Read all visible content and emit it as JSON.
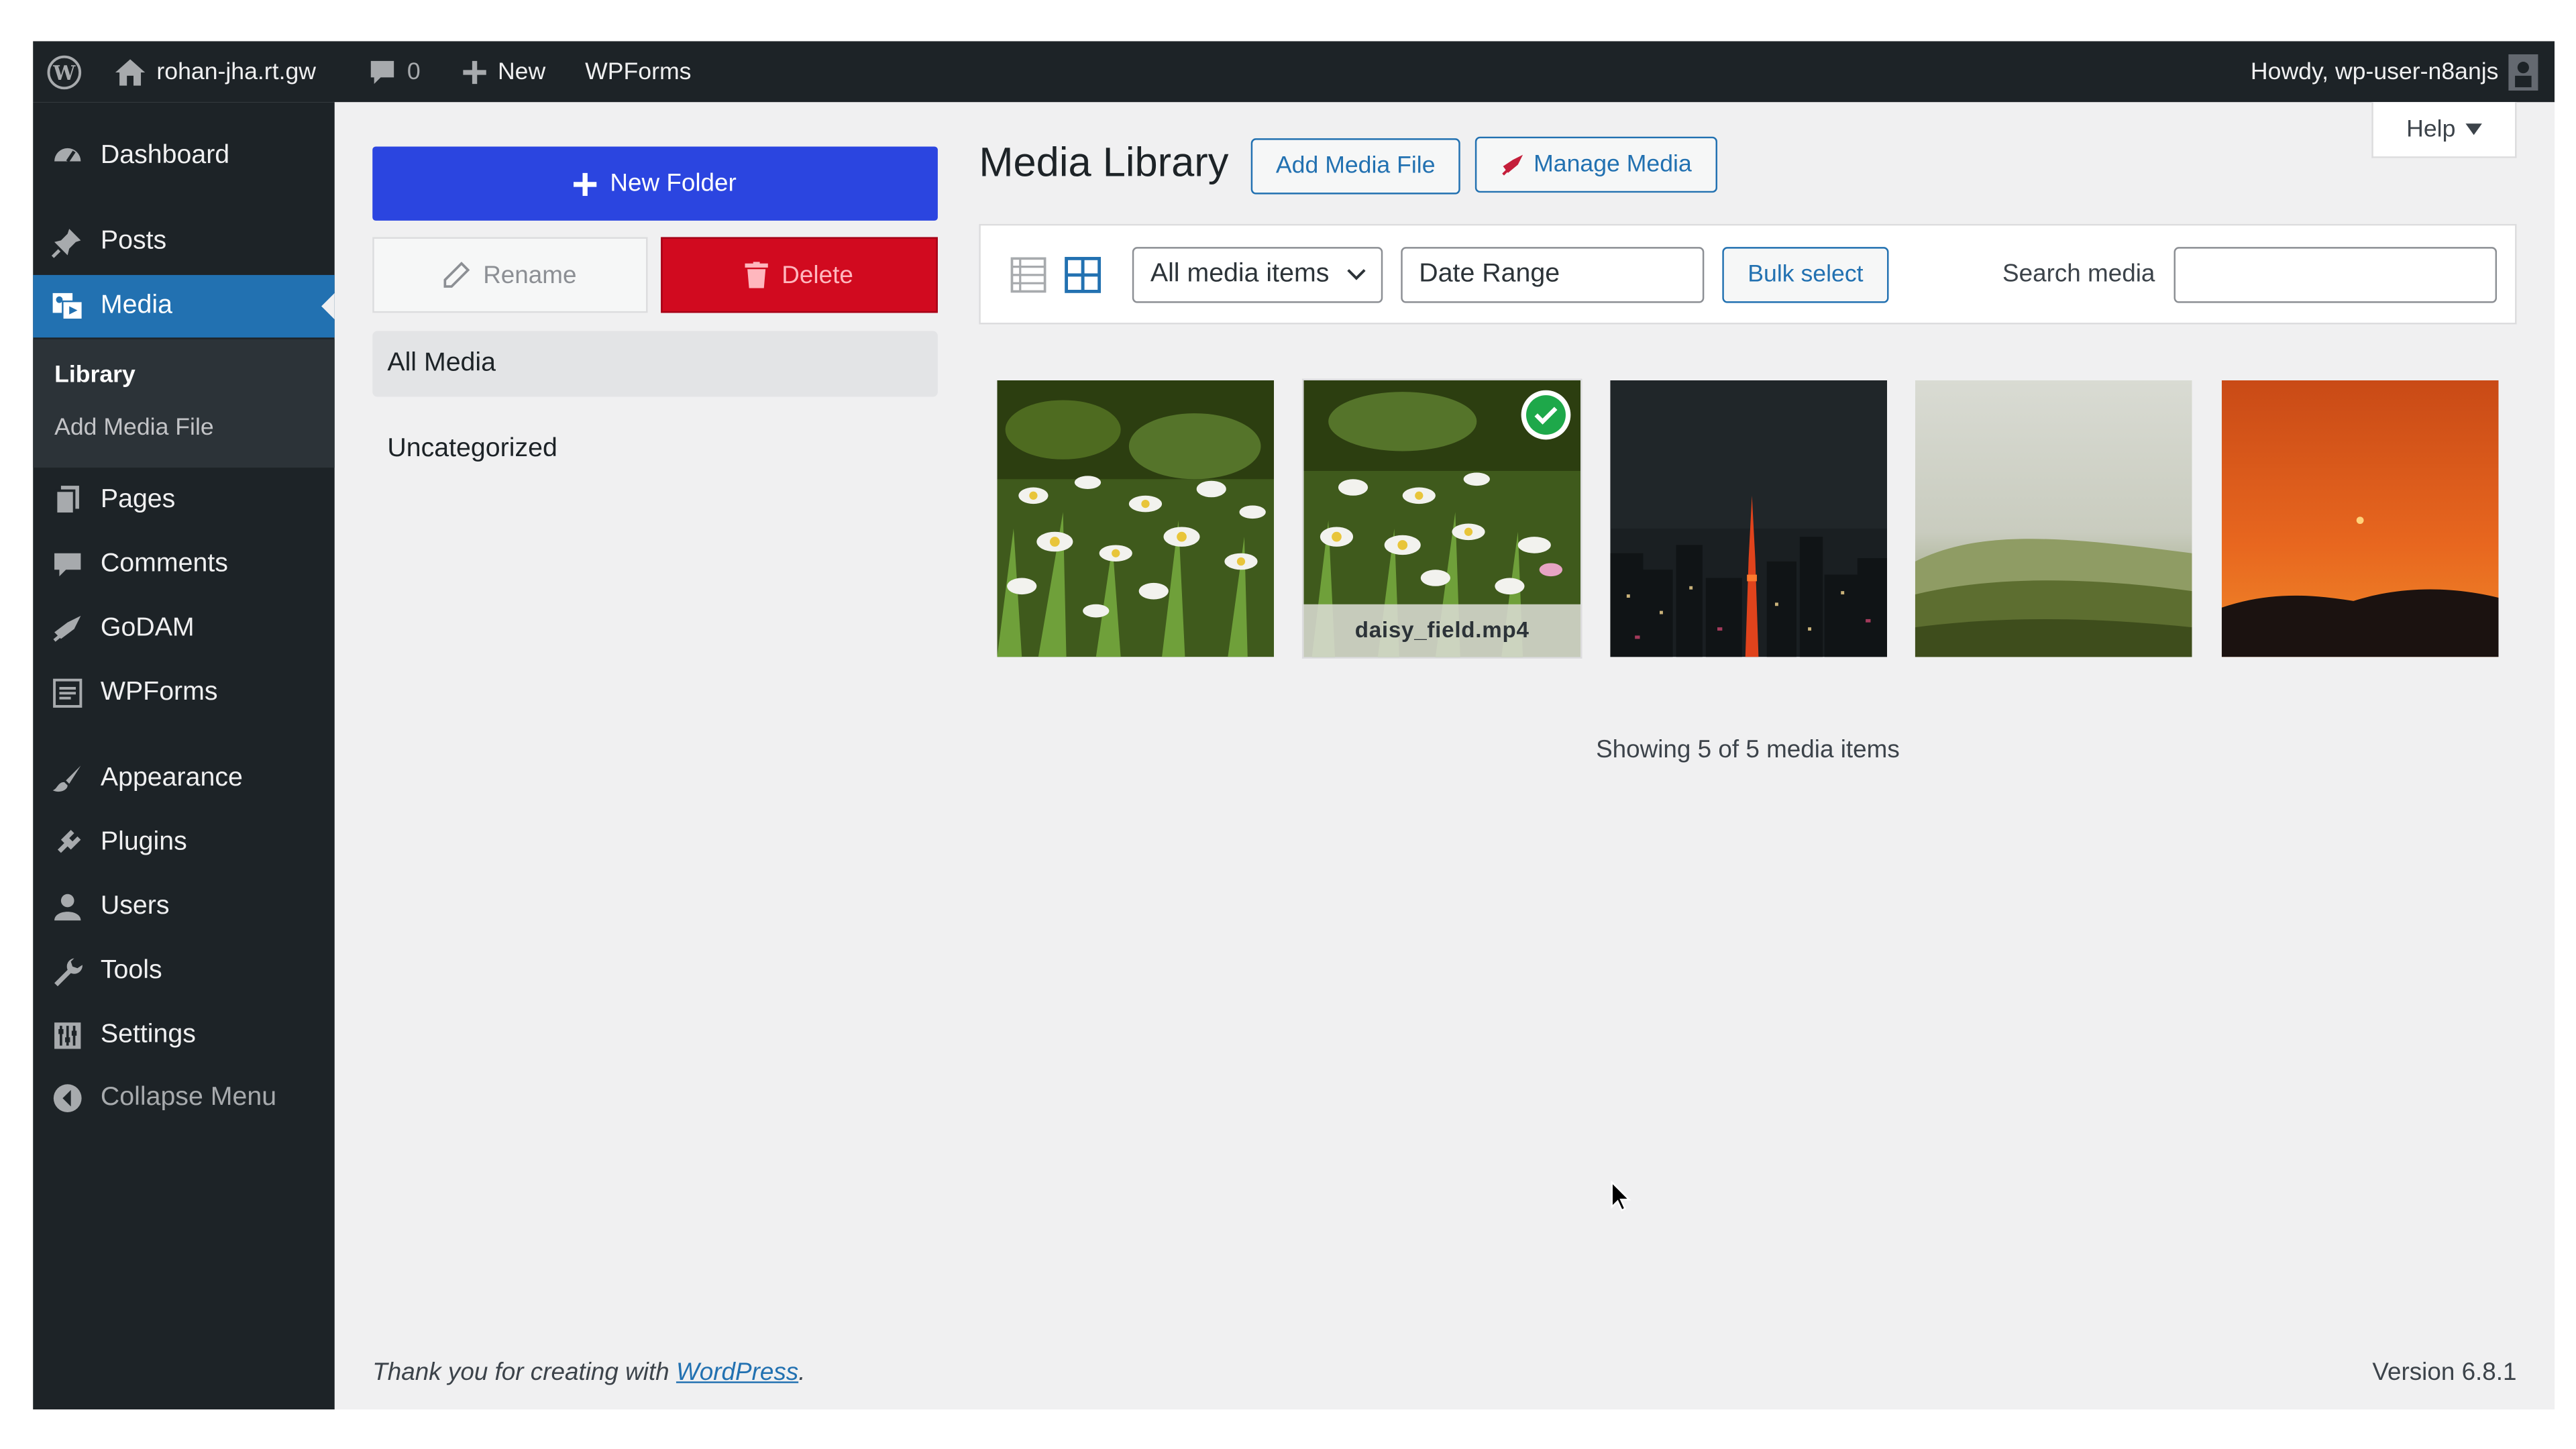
{
  "admin_bar": {
    "site_name": "rohan-jha.rt.gw",
    "comments_count": "0",
    "new_label": "New",
    "wpforms_label": "WPForms",
    "howdy": "Howdy, wp-user-n8anjs"
  },
  "sidebar": {
    "items": [
      {
        "label": "Dashboard",
        "icon": "dashboard-icon"
      },
      {
        "label": "Posts",
        "icon": "pin-icon"
      },
      {
        "label": "Media",
        "icon": "media-icon"
      },
      {
        "label": "Pages",
        "icon": "pages-icon"
      },
      {
        "label": "Comments",
        "icon": "comment-icon"
      },
      {
        "label": "GoDAM",
        "icon": "godam-icon"
      },
      {
        "label": "WPForms",
        "icon": "form-icon"
      },
      {
        "label": "Appearance",
        "icon": "brush-icon"
      },
      {
        "label": "Plugins",
        "icon": "plug-icon"
      },
      {
        "label": "Users",
        "icon": "user-icon"
      },
      {
        "label": "Tools",
        "icon": "wrench-icon"
      },
      {
        "label": "Settings",
        "icon": "sliders-icon"
      },
      {
        "label": "Collapse Menu",
        "icon": "collapse-icon"
      }
    ],
    "submenu": [
      {
        "label": "Library"
      },
      {
        "label": "Add Media File"
      }
    ]
  },
  "folders": {
    "new_folder": "New Folder",
    "rename": "Rename",
    "delete": "Delete",
    "items": [
      {
        "label": "All Media"
      },
      {
        "label": "Uncategorized"
      }
    ]
  },
  "header": {
    "title": "Media Library",
    "add_media": "Add Media File",
    "manage_media": "Manage Media",
    "help": "Help"
  },
  "toolbar": {
    "filter_value": "All media items",
    "date_range": "Date Range",
    "bulk_select": "Bulk select",
    "search_label": "Search media",
    "search_value": ""
  },
  "media": {
    "hover_filename": "daisy_field.mp4",
    "showing": "Showing 5 of 5 media items"
  },
  "footer": {
    "thank_you": "Thank you for creating with ",
    "wordpress_link": "WordPress",
    "period": ".",
    "version": "Version 6.8.1"
  },
  "colors": {
    "admin_bar": "#1d2327",
    "accent": "#2271b1",
    "primary_button": "#2b45e0",
    "delete_button": "#d10a1f",
    "check_badge": "#1ea84a"
  }
}
